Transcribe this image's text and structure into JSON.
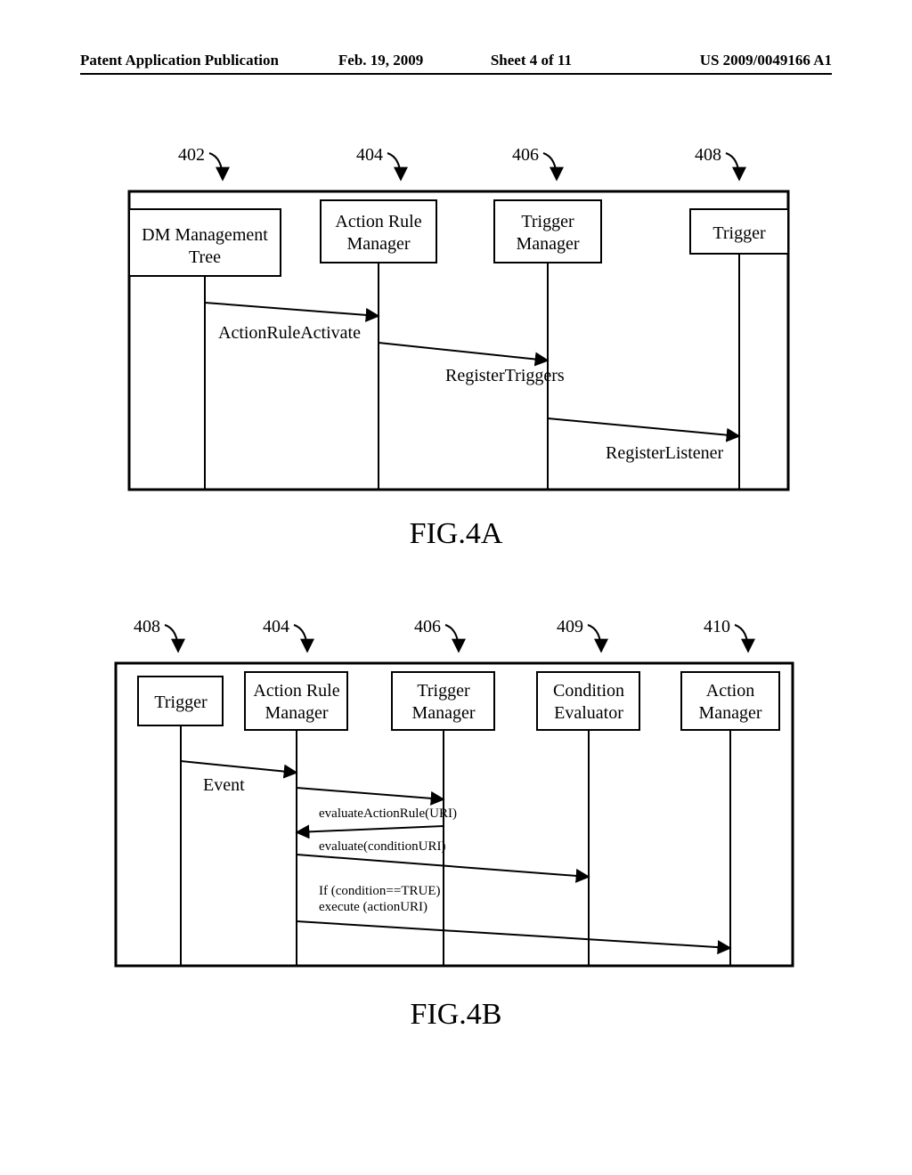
{
  "header": {
    "left": "Patent Application Publication",
    "date": "Feb. 19, 2009",
    "sheet": "Sheet 4 of 11",
    "pubno": "US 2009/0049166 A1"
  },
  "figA": {
    "caption": "FIG.4A",
    "refs": {
      "r402": "402",
      "r404": "404",
      "r406": "406",
      "r408": "408"
    },
    "boxes": {
      "dmtree_l1": "DM Management",
      "dmtree_l2": "Tree",
      "arm_l1": "Action Rule",
      "arm_l2": "Manager",
      "tm_l1": "Trigger",
      "tm_l2": "Manager",
      "trig": "Trigger"
    },
    "msgs": {
      "m1": "ActionRuleActivate",
      "m2": "RegisterTriggers",
      "m3": "RegisterListener"
    }
  },
  "figB": {
    "caption": "FIG.4B",
    "refs": {
      "r408": "408",
      "r404": "404",
      "r406": "406",
      "r409": "409",
      "r410": "410"
    },
    "boxes": {
      "trig": "Trigger",
      "arm_l1": "Action Rule",
      "arm_l2": "Manager",
      "tm_l1": "Trigger",
      "tm_l2": "Manager",
      "ce_l1": "Condition",
      "ce_l2": "Evaluator",
      "am_l1": "Action",
      "am_l2": "Manager"
    },
    "msgs": {
      "m1": "Event",
      "m2": "evaluateActionRule(URI)",
      "m3": "evaluate(conditionURI)",
      "m4a": "If (condition==TRUE)",
      "m4b": "execute (actionURI)"
    }
  }
}
